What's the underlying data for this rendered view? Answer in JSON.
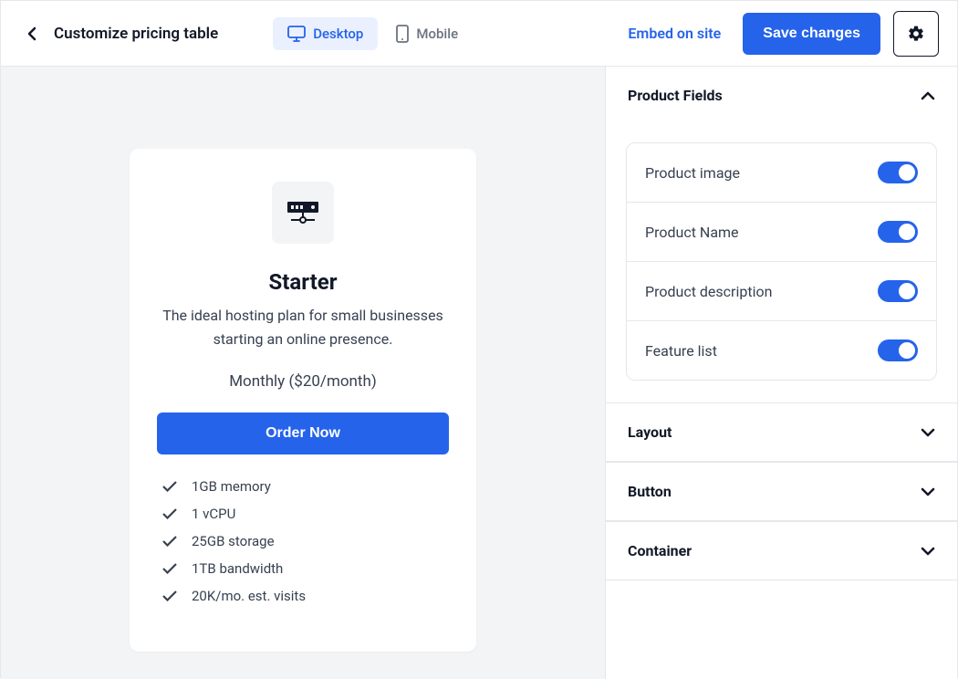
{
  "header": {
    "title": "Customize pricing table",
    "desktop_label": "Desktop",
    "mobile_label": "Mobile",
    "embed_label": "Embed on site",
    "save_label": "Save changes"
  },
  "card": {
    "name": "Starter",
    "description": "The ideal hosting plan for small businesses starting an online presence.",
    "price_text": "Monthly ($20/month)",
    "button_label": "Order Now",
    "features": [
      "1GB memory",
      "1 vCPU",
      "25GB storage",
      "1TB bandwidth",
      "20K/mo. est. visits"
    ]
  },
  "sidebar": {
    "sections": {
      "product_fields": "Product Fields",
      "layout": "Layout",
      "button": "Button",
      "container": "Container"
    },
    "fields": {
      "product_image": "Product image",
      "product_name": "Product Name",
      "product_description": "Product description",
      "feature_list": "Feature list"
    }
  }
}
